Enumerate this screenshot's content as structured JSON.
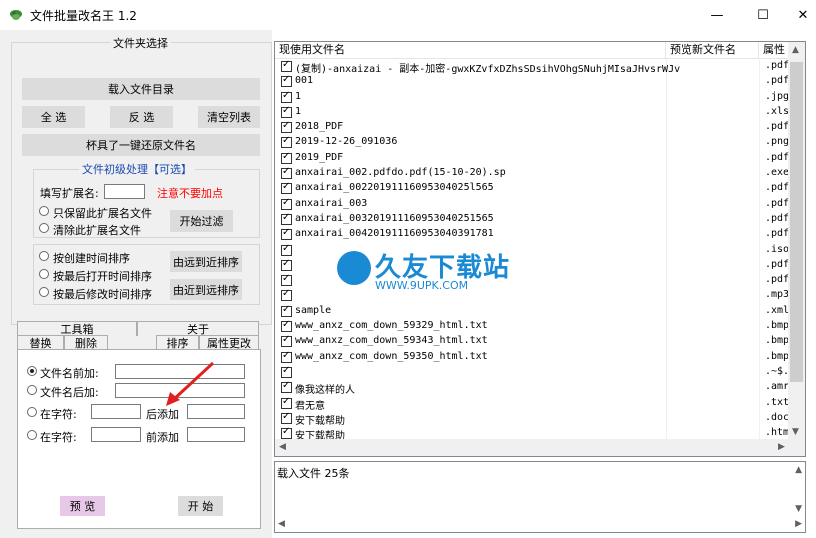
{
  "window": {
    "title": "文件批量改名王 1.2",
    "min": "—",
    "max": "☐",
    "close": "✕"
  },
  "folder_select": {
    "title": "文件夹选择",
    "load_dir": "载入文件目录",
    "select_all": "全 选",
    "invert": "反 选",
    "clear": "清空列表",
    "restore": "杯具了一键还原文件名"
  },
  "pre_process": {
    "title": "文件初级处理【可选】",
    "ext_label": "填写扩展名:",
    "ext_value": "",
    "warning": "注意不要加点",
    "keep_only": "只保留此扩展名文件",
    "remove": "清除此扩展名文件",
    "filter_btn": "开始过滤"
  },
  "sort_options": {
    "by_created": "按创建时间排序",
    "by_opened": "按最后打开时间排序",
    "by_modified": "按最后修改时间排序",
    "far_to_near": "由远到近排序",
    "near_to_far": "由近到远排序"
  },
  "toolbox": {
    "title": "工具箱",
    "about": "关于",
    "tabs": [
      "替换",
      "删除",
      "添加",
      "排序",
      "属性更改"
    ],
    "active_tab": "添加"
  },
  "add_tab": {
    "prefix_label": "文件名前加:",
    "suffix_label": "文件名后加:",
    "at_char_1": "在字符:",
    "after_add": "后添加",
    "at_char_2": "在字符:",
    "before_add": "前添加",
    "preview": "预 览",
    "start": "开 始"
  },
  "list": {
    "col_current": "现使用文件名",
    "col_preview": "预览新文件名",
    "col_attr": "属性",
    "rows": [
      {
        "name": "(复制)-anxaizai - 副本-加密-gwxKZvfxDZhsSDsihVOhgSNuhjMIsaJHvsrWJv",
        "ext": ".pdf"
      },
      {
        "name": "001",
        "ext": ".pdf"
      },
      {
        "name": "1",
        "ext": ".jpg"
      },
      {
        "name": "1",
        "ext": ".xlsm"
      },
      {
        "name": "2018_PDF",
        "ext": ".pdf"
      },
      {
        "name": "2019-12-26_091036",
        "ext": ".png"
      },
      {
        "name": "2019_PDF",
        "ext": ".pdf"
      },
      {
        "name": "anxairai_002.pdfdo.pdf(15-10-20).sp",
        "ext": ".exe"
      },
      {
        "name": "anxairai_00220191116095304025l565",
        "ext": ".pdf"
      },
      {
        "name": "anxairai_003",
        "ext": ".pdf"
      },
      {
        "name": "anxairai_003201911160953040251565",
        "ext": ".pdf"
      },
      {
        "name": "anxairai_004201911160953040391781",
        "ext": ".pdf"
      },
      {
        "name": "",
        "ext": ".iso"
      },
      {
        "name": "",
        "ext": ".pdf"
      },
      {
        "name": "",
        "ext": ".pdf"
      },
      {
        "name": "",
        "ext": ".mp3"
      },
      {
        "name": "sample",
        "ext": ".xml"
      },
      {
        "name": "www_anxz_com_down_59329_html.txt",
        "ext": ".bmp"
      },
      {
        "name": "www_anxz_com_down_59343_html.txt",
        "ext": ".bmp"
      },
      {
        "name": "www_anxz_com_down_59350_html.txt",
        "ext": ".bmp"
      },
      {
        "name": "",
        "ext": ".~$..."
      },
      {
        "name": "像我这样的人",
        "ext": ".amr"
      },
      {
        "name": "君无意",
        "ext": ".txt"
      },
      {
        "name": "安下载帮助",
        "ext": ".doc"
      },
      {
        "name": "安下载帮助",
        "ext": ".htm"
      }
    ]
  },
  "status": {
    "text": "载入文件  25条"
  },
  "watermark": {
    "brand": "久友下载站",
    "url": "WWW.9UPK.COM",
    "prefix": "WWW.9U"
  },
  "colors": {
    "warning": "#ff0000",
    "button": "#dcdcdc",
    "preview_btn": "#e8c8e8"
  }
}
